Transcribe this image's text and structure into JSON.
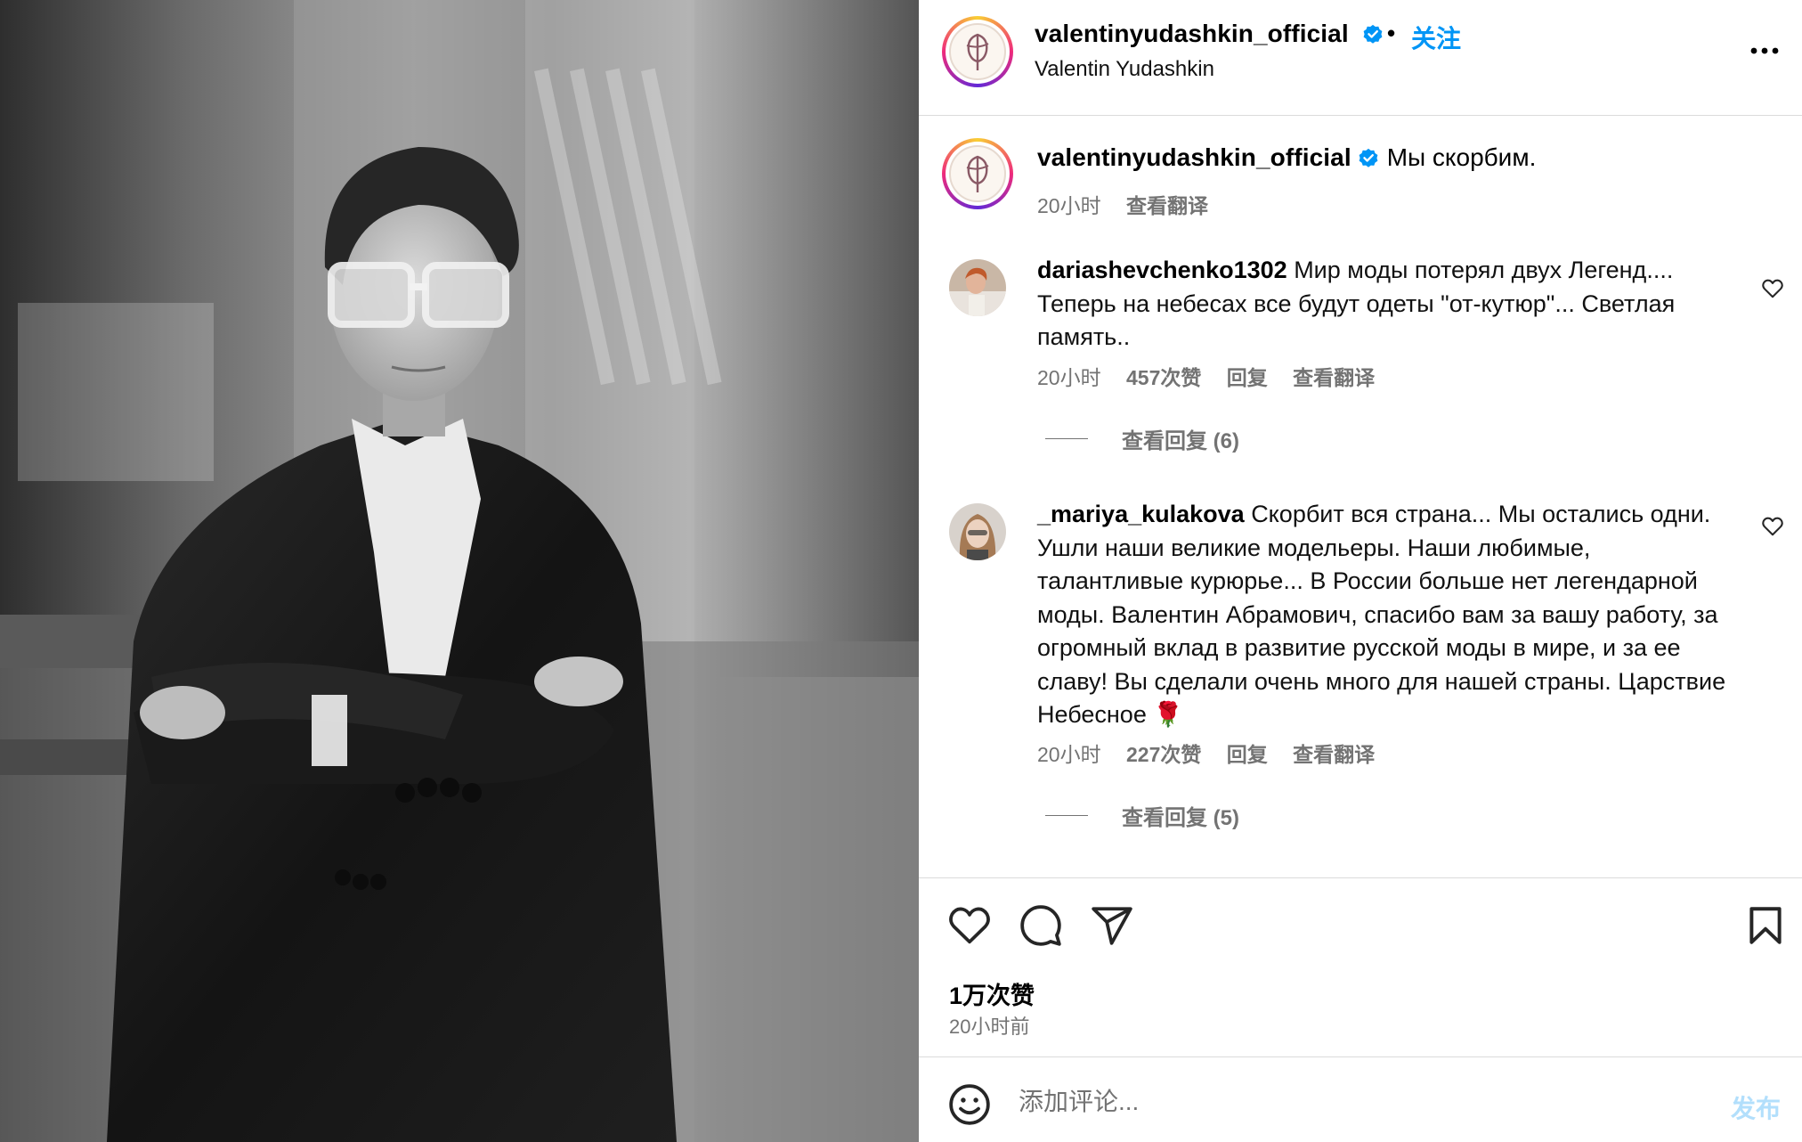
{
  "post": {
    "photo_alt": "Black and white portrait photo",
    "header": {
      "username": "valentinyudashkin_official",
      "separator": "•",
      "follow_label": "关注",
      "full_name": "Valentin Yudashkin"
    },
    "caption": {
      "username": "valentinyudashkin_official",
      "text": "Мы скорбим.",
      "time": "20小时",
      "translate": "查看翻译"
    },
    "comments": [
      {
        "username": "dariashevchenko1302",
        "text": "Мир моды потерял двух Легенд.... Теперь на небесах все будут одеты \"от-кутюр\"... Светлая память..",
        "time": "20小时",
        "likes": "457次赞",
        "reply": "回复",
        "translate": "查看翻译",
        "view_replies": "查看回复 (6)"
      },
      {
        "username": "_mariya_kulakova",
        "text": "Скорбит вся страна... Мы остались одни. Ушли наши великие модельеры. Наши любимые, талантливые курюрье... В России больше нет легендарной моды. Валентин Абрамович, спасибо вам за вашу работу, за огромный вклад в развитие русской моды в мире, и за ее славу! Вы сделали очень много для нашей страны. Царствие Небесное 🌹",
        "time": "20小时",
        "likes": "227次赞",
        "reply": "回复",
        "translate": "查看翻译",
        "view_replies": "查看回复 (5)"
      }
    ],
    "likes_count": "1万次赞",
    "posted_ago": "20小时前",
    "add_comment": {
      "placeholder": "添加评论...",
      "post_label": "发布"
    }
  },
  "colors": {
    "accent": "#0095f6",
    "post_disabled": "#b2dffc",
    "muted": "#737373",
    "divider": "#dbdbdb"
  },
  "icons": [
    "verified-badge-icon",
    "more-options-icon",
    "heart-icon",
    "comment-icon",
    "share-icon",
    "bookmark-icon",
    "emoji-icon"
  ]
}
